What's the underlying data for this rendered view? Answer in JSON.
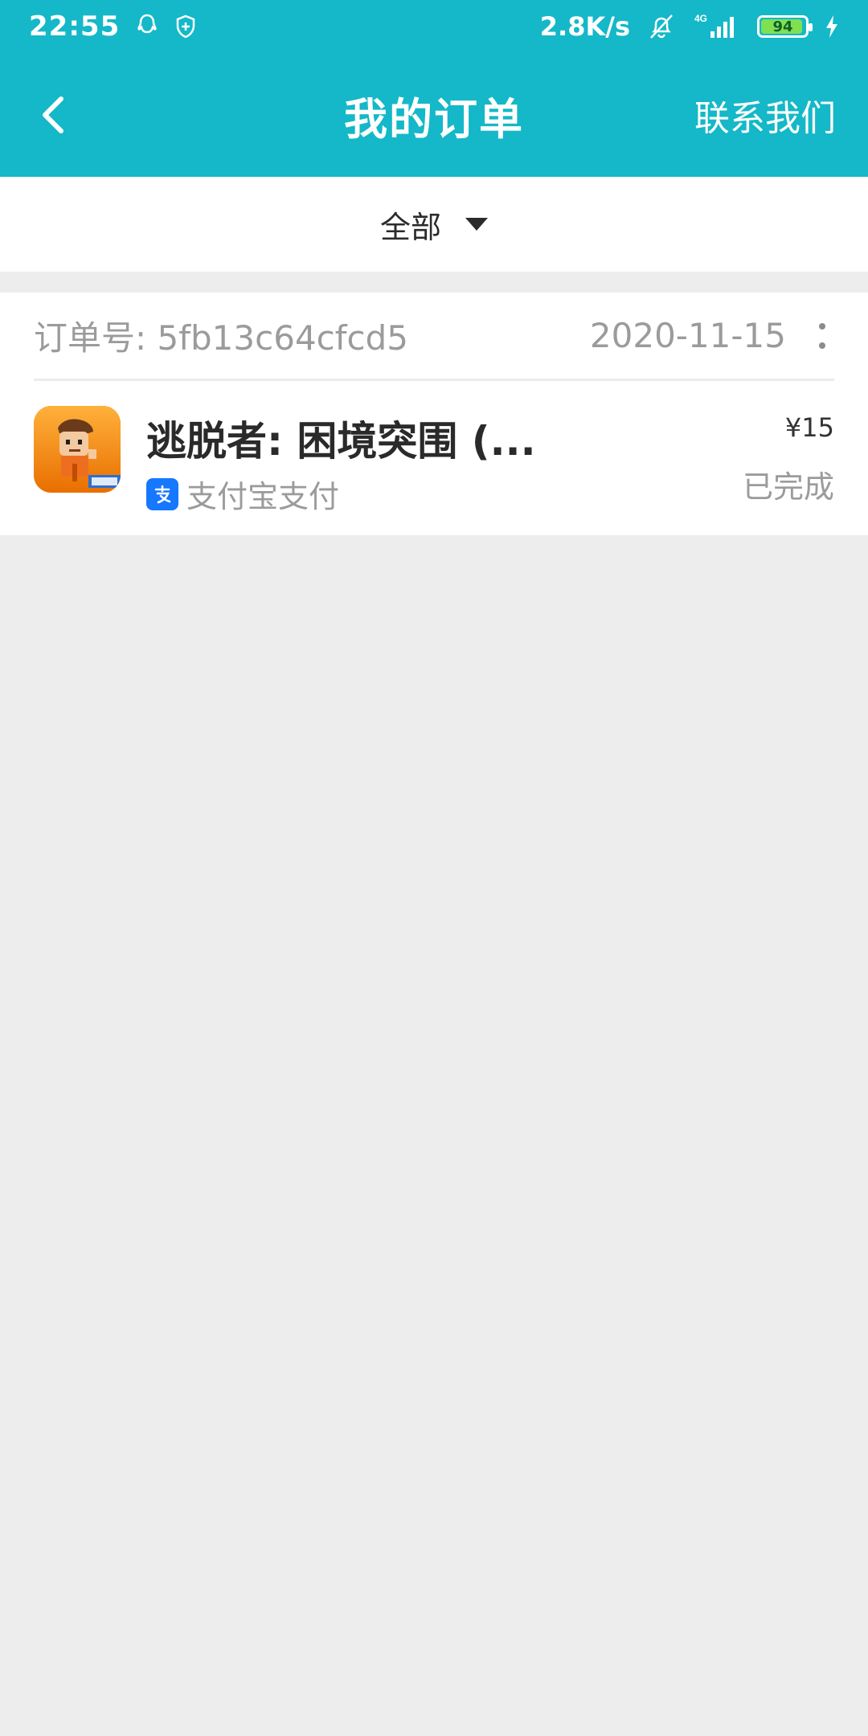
{
  "status_bar": {
    "time": "22:55",
    "net_speed": "2.8K/s",
    "network": "4G",
    "battery": "94",
    "battery_level": 0.94
  },
  "header": {
    "title": "我的订单",
    "contact_label": "联系我们"
  },
  "filter": {
    "selected": "全部"
  },
  "order": {
    "id_label": "订单号: ",
    "id_value": "5fb13c64cfcd5",
    "date": "2020-11-15",
    "item_name": "逃脱者: 困境突围 (...",
    "payment_method": "支付宝支付",
    "price": "¥15",
    "status": "已完成"
  },
  "colors": {
    "header_bg": "#14b8c8",
    "background": "#ededed",
    "alipay_blue": "#1677ff"
  },
  "icons": {
    "back": "back-arrow-icon",
    "more": "more-vertical-icon",
    "payment": "alipay-icon"
  }
}
